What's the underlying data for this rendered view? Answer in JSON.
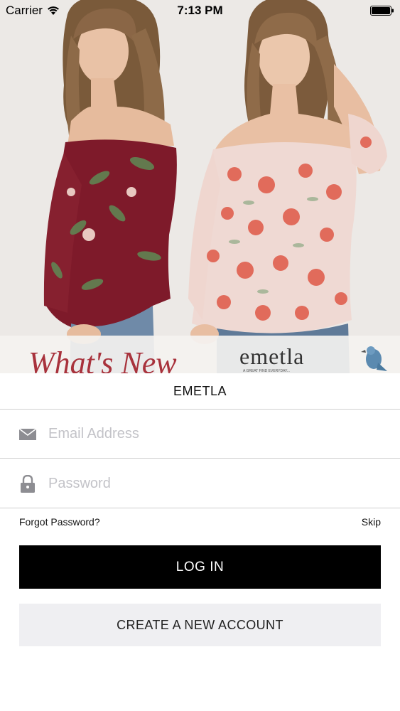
{
  "status_bar": {
    "carrier": "Carrier",
    "time": "7:13 PM"
  },
  "hero": {
    "banner_left_text": "What's New",
    "logo_text": "emetla",
    "logo_sub_text": "A GREAT FIND EVERYDAY..."
  },
  "brand": {
    "title": "EMETLA"
  },
  "form": {
    "email_placeholder": "Email Address",
    "email_value": "",
    "password_placeholder": "Password",
    "password_value": "",
    "forgot_label": "Forgot Password?",
    "skip_label": "Skip",
    "login_label": "LOG IN",
    "create_label": "CREATE A NEW ACCOUNT"
  },
  "icons": {
    "email": "envelope-icon",
    "password": "lock-icon",
    "wifi": "wifi-icon",
    "battery": "battery-icon"
  },
  "colors": {
    "login_bg": "#000000",
    "create_bg": "#efeff2",
    "placeholder": "#c3c3c8",
    "divider": "#cfcfcf"
  }
}
